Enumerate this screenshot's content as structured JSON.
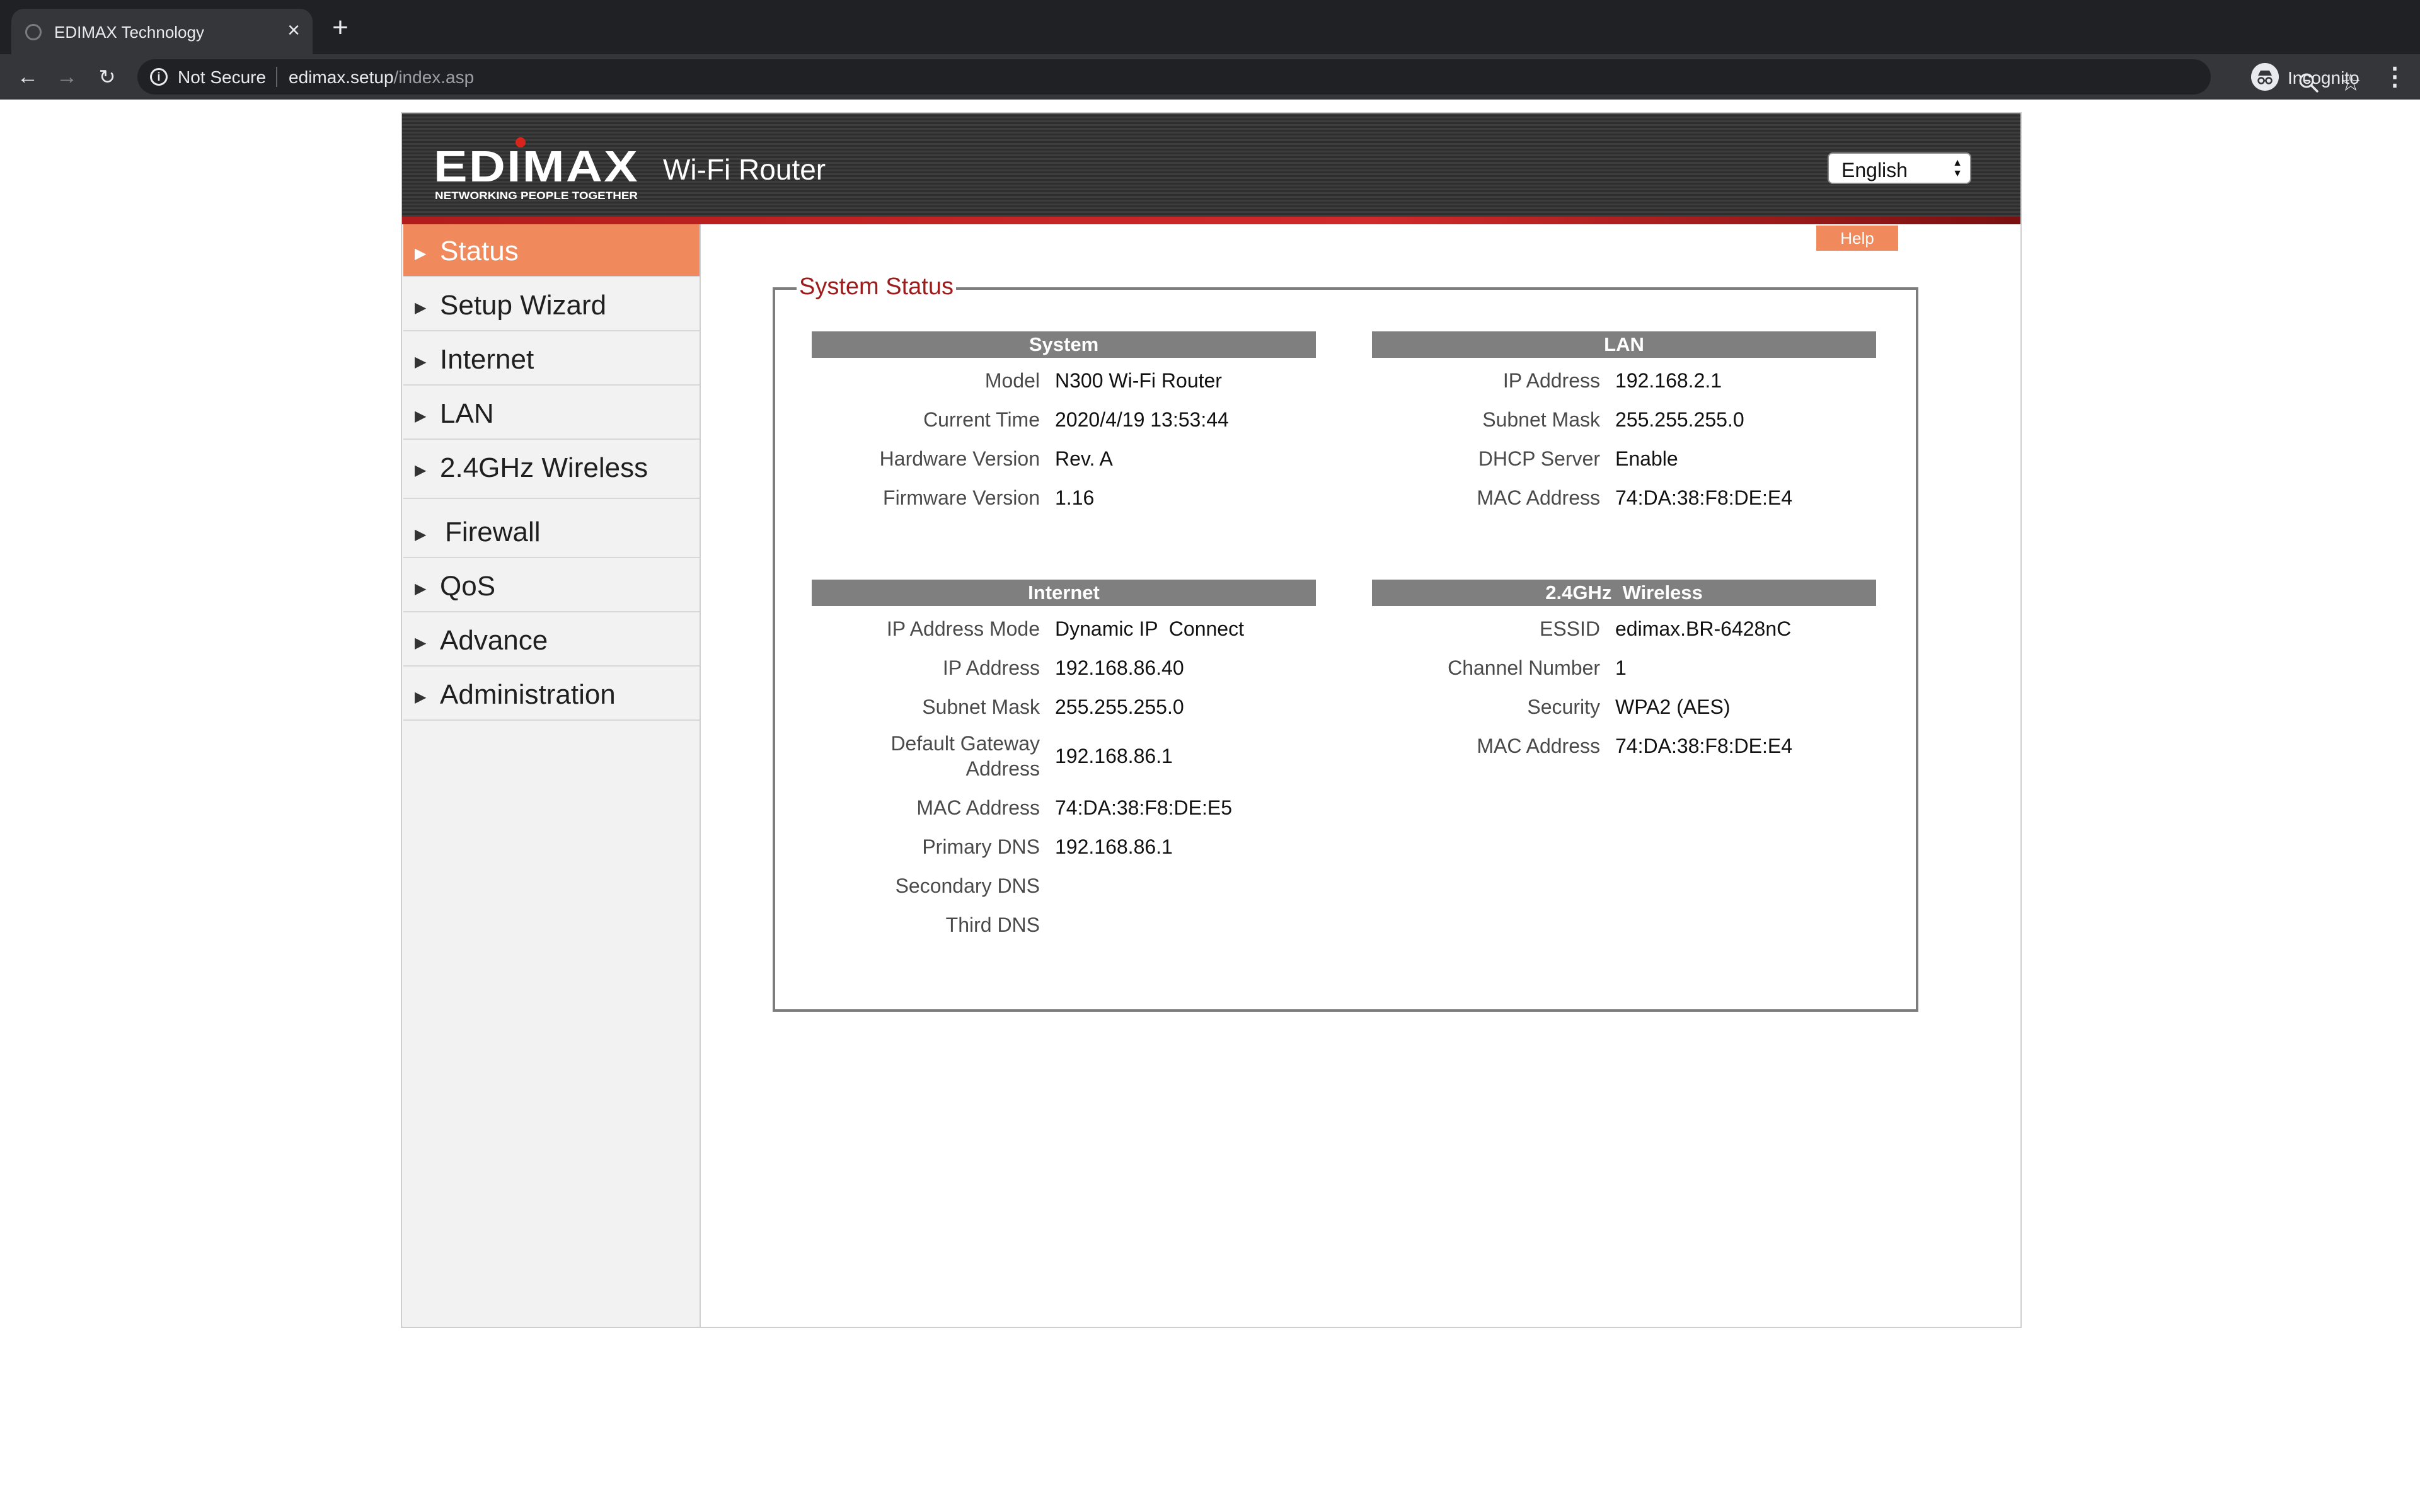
{
  "browser": {
    "tab_title": "EDIMAX Technology",
    "security_label": "Not Secure",
    "url_host": "edimax.setup",
    "url_path": "/index.asp",
    "profile_label": "Incognito"
  },
  "header": {
    "brand": "EDIMAX",
    "brand_tagline": "NETWORKING PEOPLE TOGETHER",
    "product_title": "Wi-Fi Router",
    "language": "English"
  },
  "nav": [
    {
      "label": "Status",
      "active": true
    },
    {
      "label": "Setup Wizard"
    },
    {
      "label": "Internet"
    },
    {
      "label": "LAN"
    },
    {
      "label": "2.4GHz Wireless"
    },
    {
      "label": "Firewall"
    },
    {
      "label": "QoS"
    },
    {
      "label": "Advance"
    },
    {
      "label": "Administration"
    }
  ],
  "help_label": "Help",
  "status_title": "System Status",
  "sections": {
    "system": {
      "title": "System",
      "rows": [
        {
          "label": "Model",
          "value": "N300 Wi-Fi Router"
        },
        {
          "label": "Current Time",
          "value": "2020/4/19 13:53:44"
        },
        {
          "label": "Hardware Version",
          "value": "Rev. A"
        },
        {
          "label": "Firmware Version",
          "value": "1.16"
        }
      ]
    },
    "lan": {
      "title": "LAN",
      "rows": [
        {
          "label": "IP Address",
          "value": "192.168.2.1"
        },
        {
          "label": "Subnet Mask",
          "value": "255.255.255.0"
        },
        {
          "label": "DHCP Server",
          "value": "Enable"
        },
        {
          "label": "MAC Address",
          "value": "74:DA:38:F8:DE:E4"
        }
      ]
    },
    "internet": {
      "title": "Internet",
      "rows": [
        {
          "label": "IP Address Mode",
          "value": "Dynamic IP  Connect"
        },
        {
          "label": "IP Address",
          "value": "192.168.86.40"
        },
        {
          "label": "Subnet Mask",
          "value": "255.255.255.0"
        },
        {
          "label": "Default Gateway Address",
          "value": "192.168.86.1"
        },
        {
          "label": "MAC Address",
          "value": "74:DA:38:F8:DE:E5"
        },
        {
          "label": "Primary DNS",
          "value": "192.168.86.1"
        },
        {
          "label": "Secondary DNS",
          "value": ""
        },
        {
          "label": "Third DNS",
          "value": ""
        }
      ]
    },
    "wireless": {
      "title": "2.4GHz  Wireless",
      "rows": [
        {
          "label": "ESSID",
          "value": "edimax.BR-6428nC"
        },
        {
          "label": "Channel Number",
          "value": "1"
        },
        {
          "label": "Security",
          "value": "WPA2 (AES)"
        },
        {
          "label": "MAC Address",
          "value": "74:DA:38:F8:DE:E4"
        }
      ]
    }
  }
}
